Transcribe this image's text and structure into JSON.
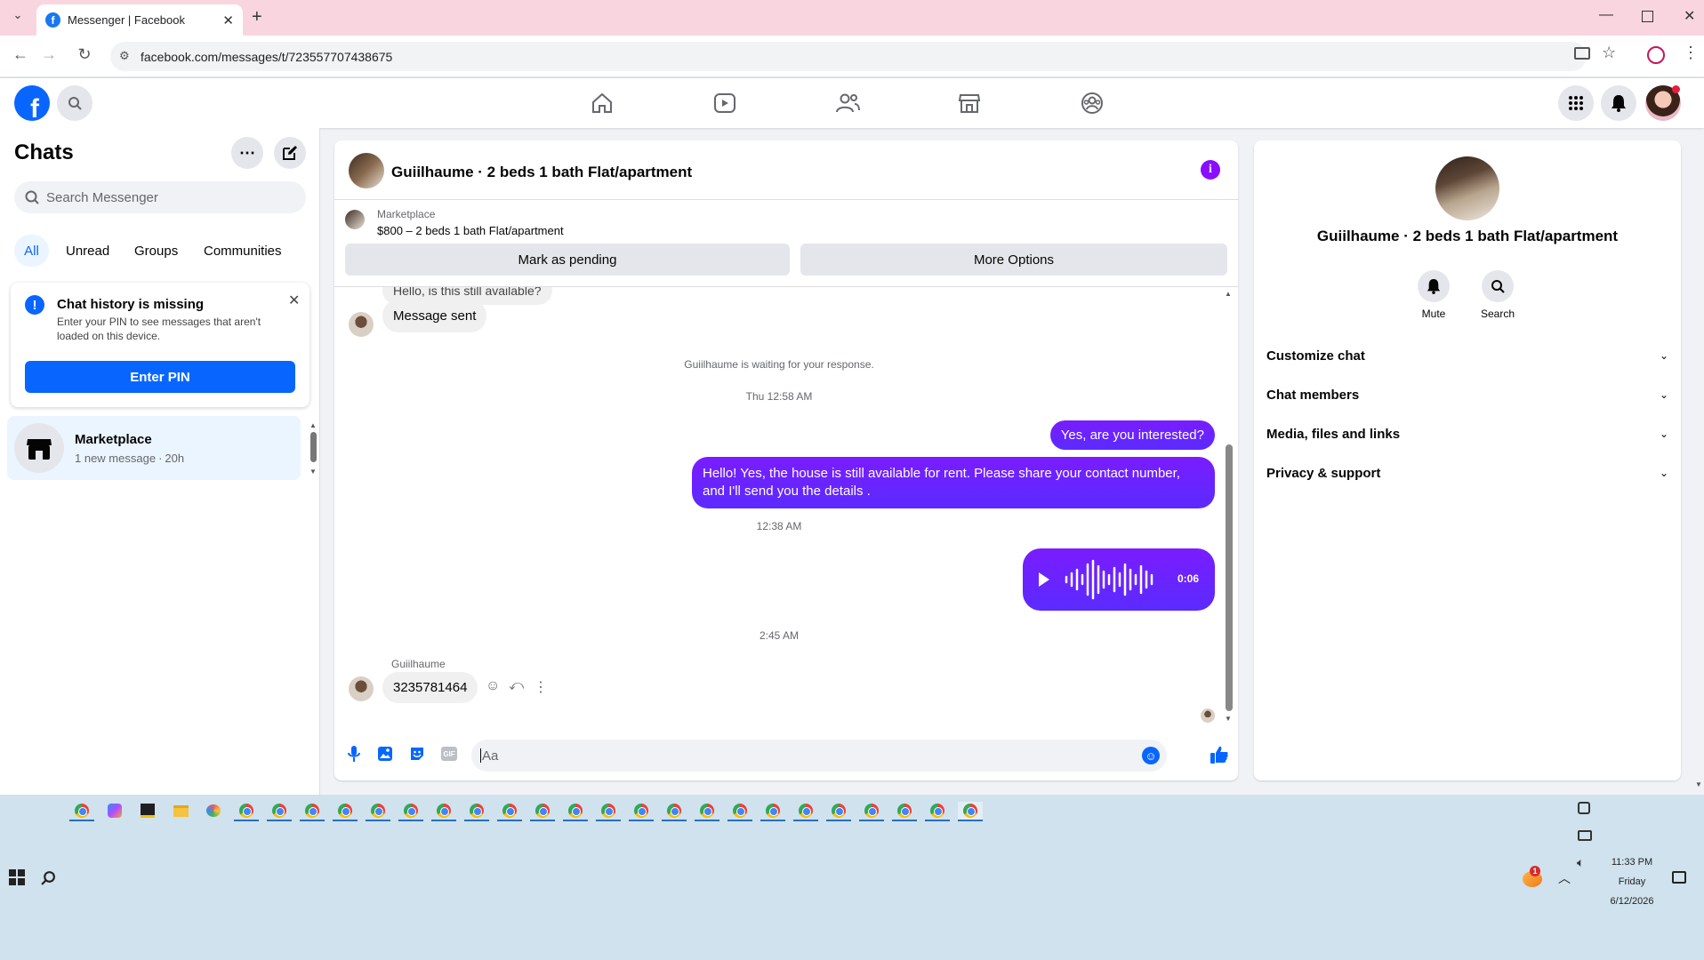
{
  "browser": {
    "tab_title": "Messenger | Facebook",
    "url": "facebook.com/messages/t/723557707438675"
  },
  "left": {
    "title": "Chats",
    "search_placeholder": "Search Messenger",
    "filters": [
      "All",
      "Unread",
      "Groups",
      "Communities"
    ],
    "notice": {
      "title": "Chat history is missing",
      "body": "Enter your PIN to see messages that aren't loaded on this device.",
      "button": "Enter PIN"
    },
    "chat": {
      "name": "Marketplace",
      "preview": "1 new message",
      "time": "20h"
    }
  },
  "convo": {
    "title": "Guiilhaume · 2 beds 1 bath Flat/apartment",
    "listing": {
      "label": "Marketplace",
      "text": "$800 – 2 beds 1 bath Flat/apartment"
    },
    "buttons": {
      "pending": "Mark as pending",
      "options": "More Options"
    },
    "msgs": {
      "cut": "Hello, is this still available?",
      "sent": "Message sent",
      "waiting": "Guiilhaume is waiting for your response.",
      "time1": "Thu 12:58 AM",
      "out1": "Yes, are you interested?",
      "out2": "Hello! Yes, the house is still available for rent. Please share your contact number, and I'll send you the details .",
      "time2": "12:38 AM",
      "voice_duration": "0:06",
      "time3": "2:45 AM",
      "sender": "Guiilhaume",
      "phone": "3235781464"
    },
    "composer_placeholder": "Aa"
  },
  "right": {
    "name": "Guiilhaume · 2 beds 1 bath Flat/apartment",
    "mute": "Mute",
    "search": "Search",
    "sections": [
      "Customize chat",
      "Chat members",
      "Media, files and links",
      "Privacy & support"
    ]
  },
  "taskbar": {
    "time": "11:33 PM",
    "day": "Friday",
    "date": "6/12/2026",
    "badge": "1"
  },
  "colors": {
    "fb_blue": "#0866ff",
    "messenger_purple": "#6b22ff",
    "tab_bg": "#f9d6df"
  }
}
